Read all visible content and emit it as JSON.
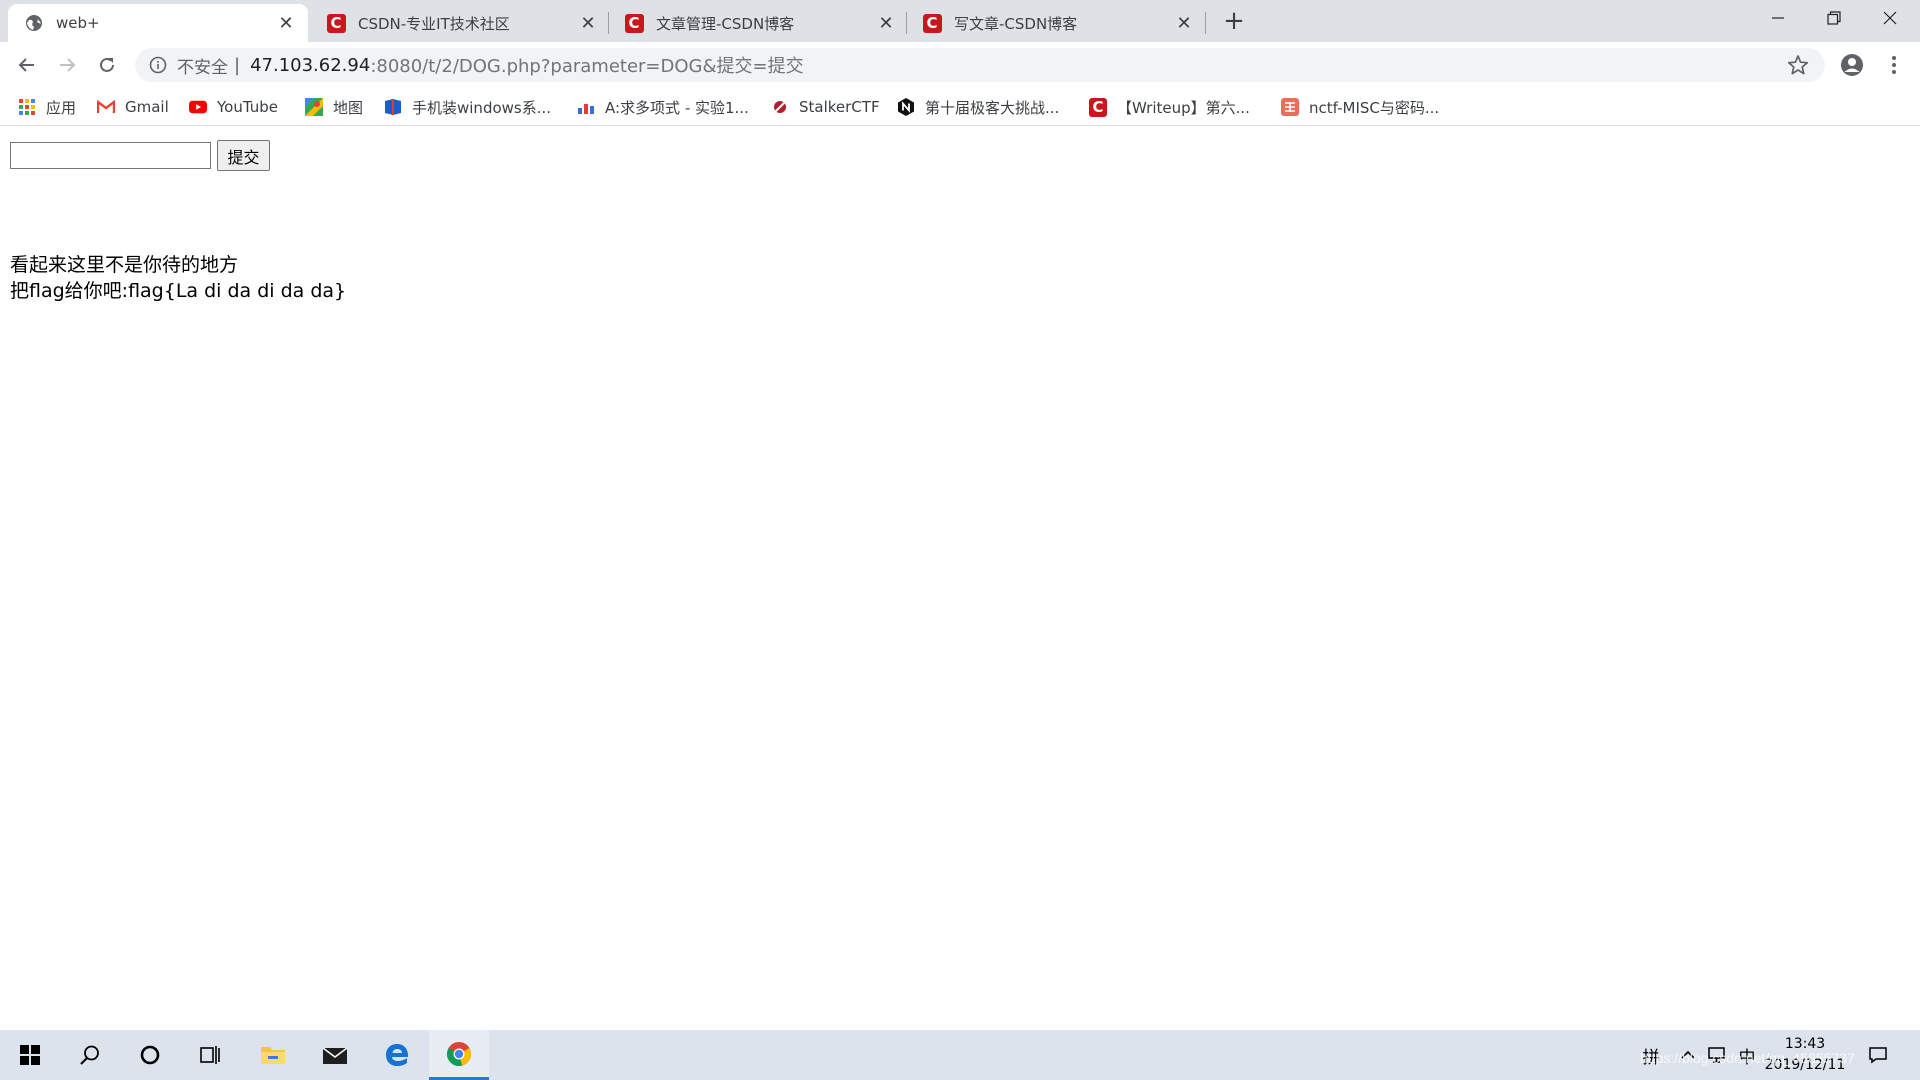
{
  "browser": {
    "tabs": [
      {
        "title": "web+",
        "icon": "globe-icon",
        "active": true
      },
      {
        "title": "CSDN-专业IT技术社区",
        "icon": "csdn-icon",
        "active": false
      },
      {
        "title": "文章管理-CSDN博客",
        "icon": "csdn-icon",
        "active": false
      },
      {
        "title": "写文章-CSDN博客",
        "icon": "csdn-icon",
        "active": false
      }
    ],
    "new_tab": "+",
    "address": {
      "security_label": "不安全",
      "separator": "|",
      "host": "47.103.62.94",
      "path": ":8080/t/2/DOG.php?parameter=DOG&提交=提交"
    },
    "bookmarks": [
      {
        "label": "应用",
        "icon": "apps-grid-icon"
      },
      {
        "label": "Gmail",
        "icon": "gmail-icon"
      },
      {
        "label": "YouTube",
        "icon": "youtube-icon"
      },
      {
        "label": "地图",
        "icon": "maps-icon"
      },
      {
        "label": "手机装windows系...",
        "icon": "bookmark-blue-icon"
      },
      {
        "label": "A:求多项式 - 实验1...",
        "icon": "bookmark-chart-icon"
      },
      {
        "label": "StalkerCTF",
        "icon": "bookmark-stalker-icon"
      },
      {
        "label": "第十届极客大挑战...",
        "icon": "bookmark-n-icon"
      },
      {
        "label": "【Writeup】第六...",
        "icon": "csdn-icon"
      },
      {
        "label": "nctf-MISC与密码...",
        "icon": "jianshu-icon"
      }
    ]
  },
  "page": {
    "input_value": "",
    "submit_label": "提交",
    "line1": "看起来这里不是你待的地方",
    "line2": "把flag给你吧:flag{La di da di da da}"
  },
  "taskbar": {
    "clock_time": "13:43",
    "clock_date": "2019/12/11",
    "ime_label": "中",
    "ime_mode": "拼"
  },
  "colors": {
    "tabstrip": "#dee1e6",
    "csdn_red": "#c9171e",
    "taskbar": "#dde3ec",
    "taskbar_accent": "#2b76d2"
  },
  "watermark": "https://blog.csdn.net/qq_45855737"
}
